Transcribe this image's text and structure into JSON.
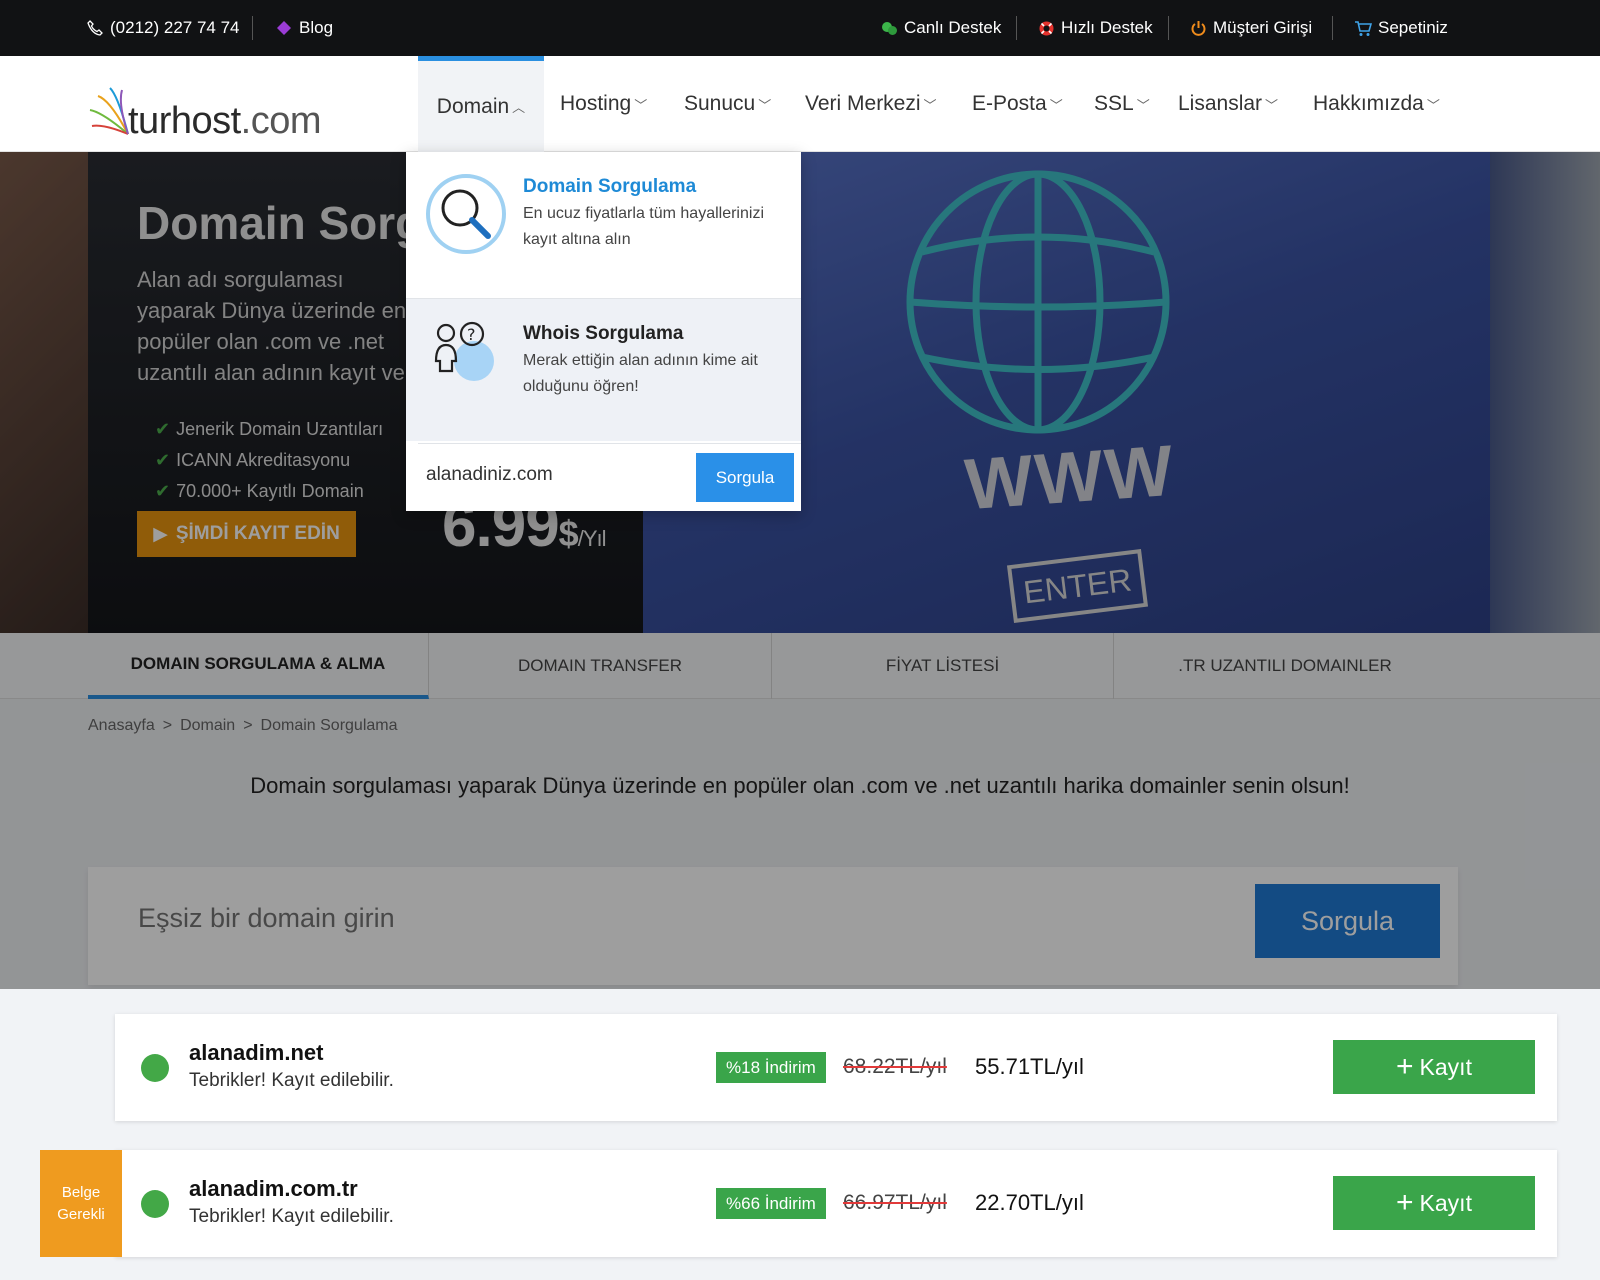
{
  "topbar": {
    "phone": "(0212) 227 74 74",
    "blog": "Blog",
    "live_support": "Canlı Destek",
    "fast_support": "Hızlı Destek",
    "customer_login": "Müşteri Girişi",
    "cart": "Sepetiniz"
  },
  "logo": {
    "name": "turhost",
    "tld": ".com"
  },
  "nav": {
    "items": [
      {
        "label": "Domain",
        "active": true
      },
      {
        "label": "Hosting"
      },
      {
        "label": "Sunucu"
      },
      {
        "label": "Veri Merkezi"
      },
      {
        "label": "E-Posta"
      },
      {
        "label": "SSL"
      },
      {
        "label": "Lisanslar"
      },
      {
        "label": "Hakkımızda"
      }
    ]
  },
  "hero": {
    "title": "Domain Sorgulama",
    "description": "Alan adı sorgulaması yaparak Dünya üzerinde en popüler olan .com ve .net uzantılı alan adının kayıt ve transfer işlemini çok kolay bir şekilde gerçekleştirin!",
    "features": [
      "Jenerik Domain Uzantıları",
      "ICANN Akreditasyonu",
      "70.000+ Kayıtlı Domain"
    ],
    "cta": "ŞİMDİ KAYIT EDİN",
    "price": "6.99",
    "currency": "$",
    "period": "/Yıl",
    "www": "WWW",
    "enter": "ENTER"
  },
  "dropdown": {
    "items": [
      {
        "title": "Domain Sorgulama",
        "desc": "En ucuz fiyatlarla tüm hayallerinizi kayıt altına alın",
        "icon": "magnifier-icon"
      },
      {
        "title": "Whois Sorgulama",
        "desc": "Merak ettiğin alan adının kime ait olduğunu öğren!",
        "icon": "whois-people-icon"
      }
    ],
    "input_value": "alanadiniz.com",
    "button": "Sorgula"
  },
  "tabs": [
    {
      "label": "DOMAIN SORGULAMA & ALMA",
      "active": true
    },
    {
      "label": "DOMAIN TRANSFER"
    },
    {
      "label": "FİYAT LİSTESİ"
    },
    {
      "label": ".TR UZANTILI DOMAINLER"
    }
  ],
  "breadcrumb": {
    "home": "Anasayfa",
    "section": "Domain",
    "page": "Domain Sorgulama",
    "separator": ">"
  },
  "intro": "Domain sorgulaması yaparak Dünya üzerinde en popüler olan .com ve .net uzantılı harika domainler senin olsun!",
  "search": {
    "placeholder": "Eşsiz bir domain girin",
    "button": "Sorgula"
  },
  "results": [
    {
      "domain": "alanadim.net",
      "status": "Tebrikler! Kayıt edilebilir.",
      "discount": "%18 İndirim",
      "old_price": "68.22TL/yıl",
      "new_price": "55.71TL/yıl",
      "button": "Kayıt"
    },
    {
      "domain": "alanadim.com.tr",
      "status": "Tebrikler! Kayıt edilebilir.",
      "discount": "%66 İndirim",
      "old_price": "66.97TL/yıl",
      "new_price": "22.70TL/yıl",
      "button": "Kayıt",
      "tag_line1": "Belge",
      "tag_line2": "Gerekli"
    }
  ],
  "colors": {
    "accent": "#2a8fe0",
    "green": "#3aa54a",
    "orange": "#e8950f",
    "topbar": "#111214"
  }
}
